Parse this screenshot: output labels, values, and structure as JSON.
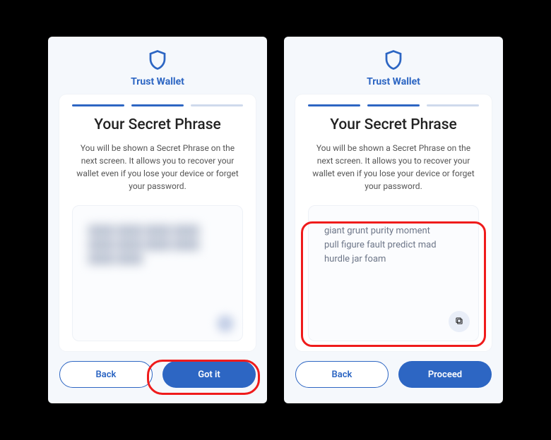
{
  "brand": "Trust Wallet",
  "left": {
    "title": "Your Secret Phrase",
    "desc": "You will be shown a Secret Phrase on the next screen. It allows you to recover your wallet even if you lose your device or forget your password.",
    "back": "Back",
    "primary": "Got it"
  },
  "right": {
    "title": "Your Secret Phrase",
    "desc": "You will be shown a Secret Phrase on the next screen. It allows you to recover your wallet even if you lose your device or forget your password.",
    "phrase": "giant grunt purity moment\npull figure fault predict mad\nhurdle jar foam",
    "back": "Back",
    "primary": "Proceed"
  }
}
